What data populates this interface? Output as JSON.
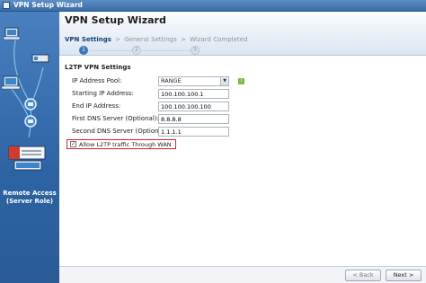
{
  "window": {
    "title": "VPN Setup Wizard"
  },
  "header": {
    "title": "VPN Setup Wizard",
    "steps": [
      {
        "label": "VPN Settings",
        "number": "1"
      },
      {
        "label": "General Settings",
        "number": "2"
      },
      {
        "label": "Wizard Completed",
        "number": "3"
      }
    ],
    "separator": ">"
  },
  "sidebar": {
    "role_line1": "Remote Access",
    "role_line2": "(Server Role)"
  },
  "section": {
    "title": "L2TP VPN Settings"
  },
  "form": {
    "ip_pool_label": "IP Address Pool:",
    "ip_pool_value": "RANGE",
    "start_ip_label": "Starting IP Address:",
    "start_ip_value": "100.100.100.1",
    "end_ip_label": "End IP Address:",
    "end_ip_value": "100.100.100.100",
    "first_dns_label": "First DNS Server (Optional):",
    "first_dns_value": "8.8.8.8",
    "second_dns_label": "Second DNS Server (Optional):",
    "second_dns_value": "1.1.1.1",
    "allow_wan_label": "Allow L2TP traffic Through WAN",
    "allow_wan_checked": true
  },
  "footer": {
    "back_label": "< Back",
    "next_label": "Next >"
  },
  "colors": {
    "accent": "#3b74b8",
    "highlight": "#d9262b",
    "info": "#7bbd3c"
  }
}
